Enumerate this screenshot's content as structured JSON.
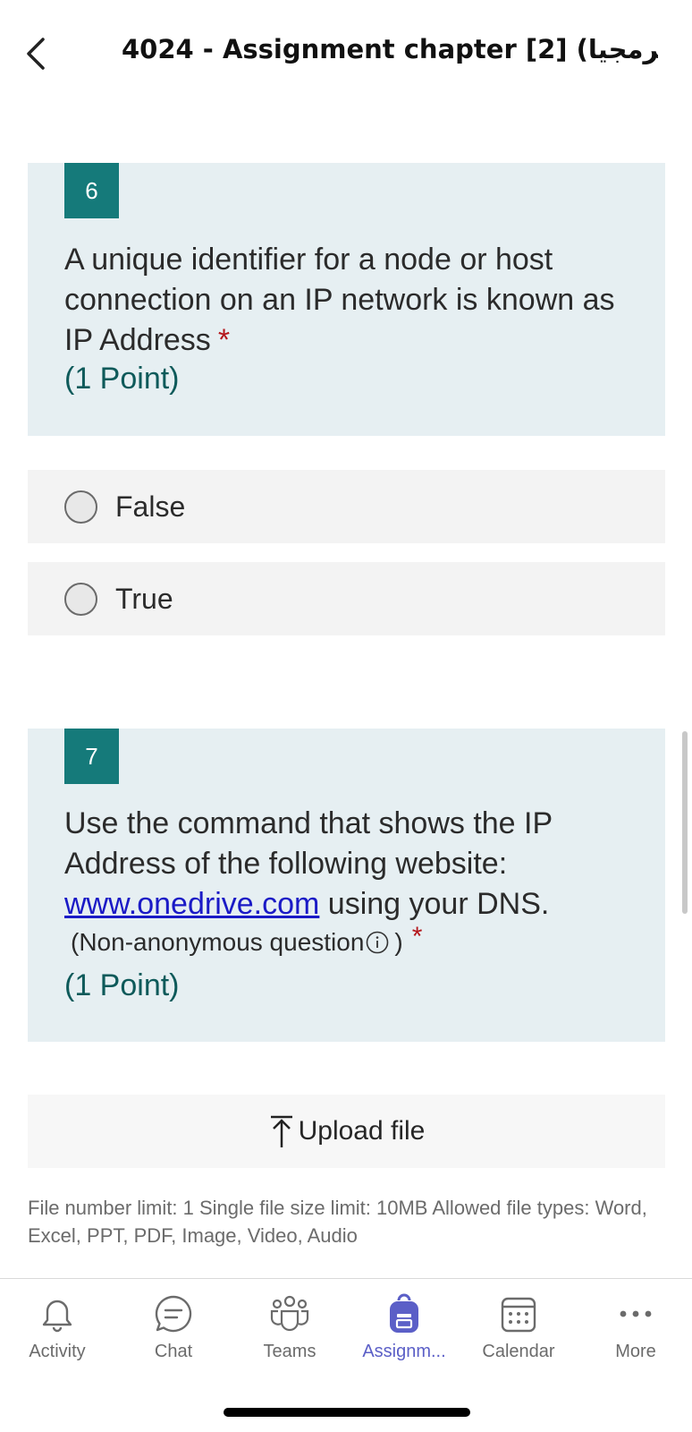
{
  "header": {
    "title": "4024 - Assignment chapter [2] (برمجيا...",
    "back_icon": "chevron-left-icon"
  },
  "questions": [
    {
      "number": "6",
      "text": "A unique identifier for a node or host connection on an IP network is known as IP Address",
      "required_mark": "*",
      "points": "(1 Point)",
      "options": [
        "False",
        "True"
      ]
    },
    {
      "number": "7",
      "text_before_link": "Use the command that shows the IP Address of the following website:",
      "link_text": "www.onedrive.com",
      "text_after_link": " using your DNS.",
      "note_open": "(Non-anonymous question",
      "note_close": ")",
      "required_mark": "*",
      "points": "(1 Point)"
    }
  ],
  "upload": {
    "label": "Upload file",
    "icon": "upload-arrow-icon",
    "info": "File number limit: 1    Single file size limit: 10MB    Allowed file types: Word, Excel, PPT, PDF, Image, Video, Audio"
  },
  "nav": {
    "items": [
      {
        "label": "Activity",
        "icon": "bell-icon"
      },
      {
        "label": "Chat",
        "icon": "chat-bubble-icon"
      },
      {
        "label": "Teams",
        "icon": "teams-people-icon"
      },
      {
        "label": "Assignm...",
        "icon": "backpack-icon",
        "active": true
      },
      {
        "label": "Calendar",
        "icon": "calendar-icon"
      },
      {
        "label": "More",
        "icon": "ellipsis-icon"
      }
    ]
  },
  "colors": {
    "accent_teal": "#157a7a",
    "points_teal": "#0e5a5a",
    "active_nav": "#5b5fc7",
    "required_red": "#b4161b",
    "question_bg": "#e6eff2"
  }
}
